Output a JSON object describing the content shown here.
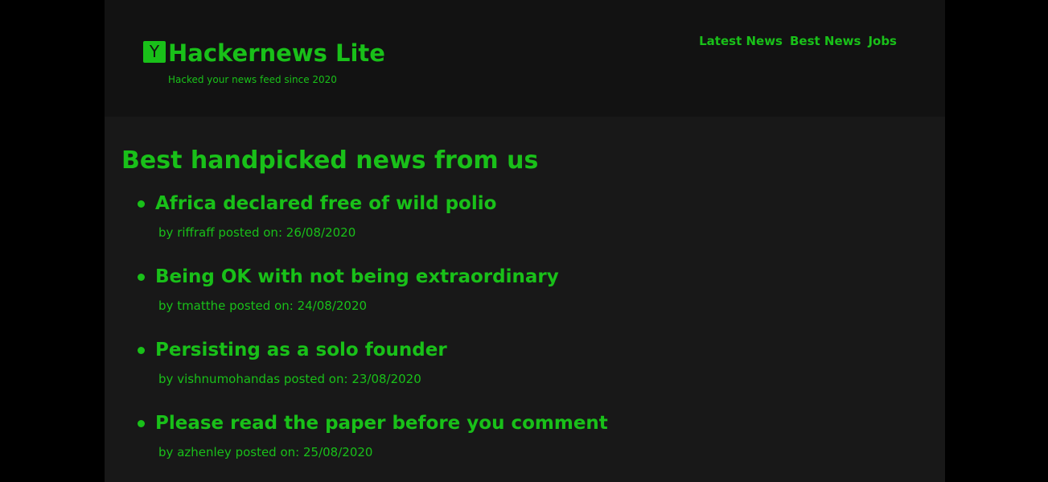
{
  "header": {
    "logo_letter": "Y",
    "title": "Hackernews Lite",
    "tagline": "Hacked your news feed since 2020",
    "nav": [
      "Latest News",
      "Best News",
      "Jobs"
    ]
  },
  "main": {
    "heading": "Best handpicked news from us",
    "by_label": "by",
    "posted_label": "posted on:",
    "items": [
      {
        "title": "Africa declared free of wild polio",
        "author": "riffraff",
        "date": "26/08/2020"
      },
      {
        "title": "Being OK with not being extraordinary",
        "author": "tmatthe",
        "date": "24/08/2020"
      },
      {
        "title": "Persisting as a solo founder",
        "author": "vishnumohandas",
        "date": "23/08/2020"
      },
      {
        "title": "Please read the paper before you comment",
        "author": "azhenley",
        "date": "25/08/2020"
      }
    ]
  },
  "colors": {
    "accent": "#19c019",
    "header_bg": "#121212",
    "body_bg": "#181818",
    "outer_bg": "#000000"
  }
}
